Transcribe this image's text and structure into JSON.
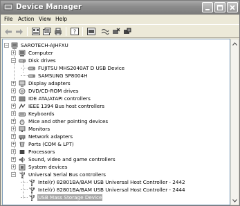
{
  "window": {
    "title": "Device Manager"
  },
  "menu": [
    "File",
    "Action",
    "View",
    "Help"
  ],
  "toolbar": {
    "buttons": [
      "back-arrow-icon",
      "forward-arrow-icon",
      "view-icon",
      "properties-icon",
      "print-icon",
      "help-icon",
      "show-icon",
      "scan-hardware-icon",
      "uninstall-icon",
      "disable-icon"
    ]
  },
  "tree": {
    "root": "SAROTECH-AJHFXU",
    "items": [
      {
        "label": "Computer",
        "level": 1,
        "expander": "+",
        "icon": "computer-icon"
      },
      {
        "label": "Disk drives",
        "level": 1,
        "expander": "-",
        "icon": "disk-drive-icon"
      },
      {
        "label": "FUJITSU MHS2040AT D USB Device",
        "level": 2,
        "icon": "disk-drive-icon"
      },
      {
        "label": "SAMSUNG SP8004H",
        "level": 2,
        "icon": "disk-drive-icon"
      },
      {
        "label": "Display adapters",
        "level": 1,
        "expander": "+",
        "icon": "display-adapter-icon"
      },
      {
        "label": "DVD/CD-ROM drives",
        "level": 1,
        "expander": "+",
        "icon": "cd-rom-icon"
      },
      {
        "label": "IDE ATA/ATAPI controllers",
        "level": 1,
        "expander": "+",
        "icon": "ide-controller-icon"
      },
      {
        "label": "IEEE 1394 Bus host controllers",
        "level": 1,
        "expander": "+",
        "icon": "firewire-icon"
      },
      {
        "label": "Keyboards",
        "level": 1,
        "expander": "+",
        "icon": "keyboard-icon"
      },
      {
        "label": "Mice and other pointing devices",
        "level": 1,
        "expander": "+",
        "icon": "mouse-icon"
      },
      {
        "label": "Monitors",
        "level": 1,
        "expander": "+",
        "icon": "monitor-icon"
      },
      {
        "label": "Network adapters",
        "level": 1,
        "expander": "+",
        "icon": "network-adapter-icon"
      },
      {
        "label": "Ports (COM & LPT)",
        "level": 1,
        "expander": "+",
        "icon": "port-icon"
      },
      {
        "label": "Processors",
        "level": 1,
        "expander": "+",
        "icon": "processor-icon"
      },
      {
        "label": "Sound, video and game controllers",
        "level": 1,
        "expander": "+",
        "icon": "sound-icon"
      },
      {
        "label": "System devices",
        "level": 1,
        "expander": "+",
        "icon": "system-device-icon"
      },
      {
        "label": "Universal Serial Bus controllers",
        "level": 1,
        "expander": "-",
        "icon": "usb-icon"
      },
      {
        "label": "Intel(r) 82801BA/BAM USB Universal Host Controller - 2442",
        "level": 2,
        "icon": "usb-icon"
      },
      {
        "label": "Intel(r) 82801BA/BAM USB Universal Host Controller - 2444",
        "level": 2,
        "icon": "usb-icon"
      },
      {
        "label": "USB Mass Storage Device",
        "level": 2,
        "icon": "usb-icon",
        "selected": true
      }
    ]
  },
  "colors": {
    "title_bar": "#8c8c8c",
    "selection": "#a9a9a9",
    "window_bg": "#ece9d8",
    "tree_border": "#7f9db9"
  }
}
